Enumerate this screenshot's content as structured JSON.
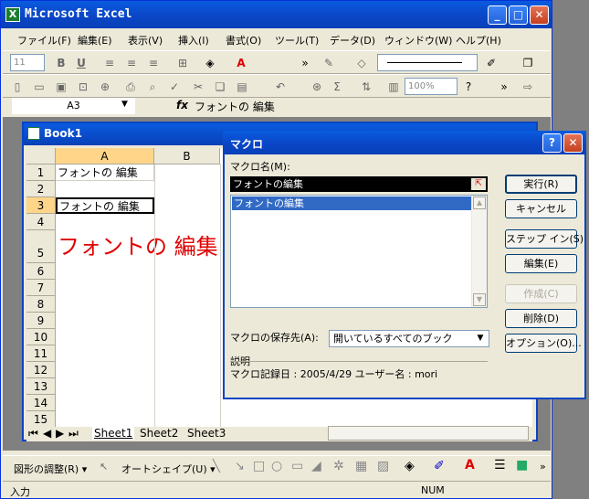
{
  "window": {
    "title": "Microsoft Excel",
    "app_icon": "X",
    "min": "_",
    "max": "□",
    "close": "✕"
  },
  "menu": [
    "ファイル(F)",
    "編集(E)",
    "表示(V)",
    "挿入(I)",
    "書式(O)",
    "ツール(T)",
    "データ(D)",
    "ウィンドウ(W)",
    "ヘルプ(H)"
  ],
  "format_toolbar": {
    "font_size": "11",
    "bold": "B",
    "underline": "U"
  },
  "standard_toolbar": {
    "zoom": "100%"
  },
  "formula_bar": {
    "name_box": "A3",
    "fx": "fx",
    "content": "フォントの 編集"
  },
  "workbook": {
    "title": "Book1",
    "columns": [
      "A",
      "B"
    ],
    "rows": [
      "1",
      "2",
      "3",
      "4",
      "5",
      "6",
      "7",
      "8",
      "9",
      "10",
      "11",
      "12",
      "13",
      "14",
      "15"
    ],
    "cells": {
      "A1": "フォントの 編集",
      "A3": "フォントの 編集",
      "A5": "フォントの 編集"
    },
    "sheet_tabs": [
      "Sheet1",
      "Sheet2",
      "Sheet3"
    ]
  },
  "macro_dialog": {
    "title": "マクロ",
    "help": "?",
    "close": "✕",
    "name_label": "マクロ名(M):",
    "name_value": "フォントの編集",
    "list": [
      "フォントの編集"
    ],
    "location_label": "マクロの保存先(A):",
    "location_value": "開いているすべてのブック",
    "description_label": "説明",
    "description_text": "マクロ記録日 : 2005/4/29  ユーザー名 : mori",
    "buttons": {
      "run": "実行(R)",
      "cancel": "キャンセル",
      "step_into": "ステップ イン(S)",
      "edit": "編集(E)",
      "create": "作成(C)",
      "delete": "削除(D)",
      "options": "オプション(O)..."
    }
  },
  "drawing_toolbar": {
    "draw": "図形の調整(R) ▾",
    "autoshapes": "オートシェイプ(U) ▾"
  },
  "status": {
    "left": "入力",
    "num": "NUM"
  },
  "colors": {
    "title_blue": "#0a45c4",
    "red_text": "#e00000",
    "selection": "#316ac5"
  }
}
